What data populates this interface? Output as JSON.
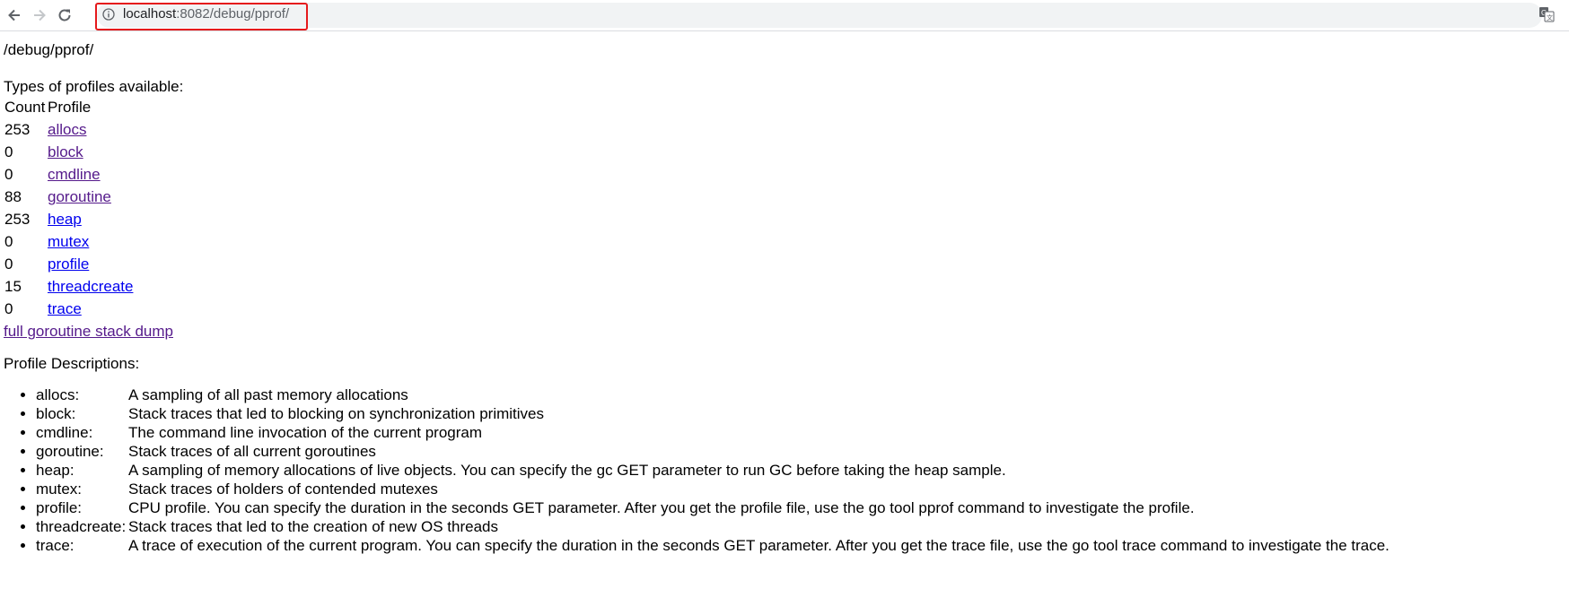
{
  "browser": {
    "url_host": "localhost",
    "url_rest": ":8082/debug/pprof/"
  },
  "page": {
    "heading": "/debug/pprof/",
    "types_heading": "Types of profiles available:",
    "table_headers": [
      "Count",
      "Profile"
    ],
    "profiles": [
      {
        "count": "253",
        "name": "allocs",
        "visited": true
      },
      {
        "count": "0",
        "name": "block",
        "visited": true
      },
      {
        "count": "0",
        "name": "cmdline",
        "visited": true
      },
      {
        "count": "88",
        "name": "goroutine",
        "visited": true
      },
      {
        "count": "253",
        "name": "heap",
        "visited": false
      },
      {
        "count": "0",
        "name": "mutex",
        "visited": false
      },
      {
        "count": "0",
        "name": "profile",
        "visited": false
      },
      {
        "count": "15",
        "name": "threadcreate",
        "visited": false
      },
      {
        "count": "0",
        "name": "trace",
        "visited": false
      }
    ],
    "dump_link": "full goroutine stack dump",
    "descriptions_heading": "Profile Descriptions:",
    "descriptions": [
      {
        "name": "allocs:",
        "text": "A sampling of all past memory allocations"
      },
      {
        "name": "block:",
        "text": "Stack traces that led to blocking on synchronization primitives"
      },
      {
        "name": "cmdline:",
        "text": "The command line invocation of the current program"
      },
      {
        "name": "goroutine:",
        "text": "Stack traces of all current goroutines"
      },
      {
        "name": "heap:",
        "text": "A sampling of memory allocations of live objects. You can specify the gc GET parameter to run GC before taking the heap sample."
      },
      {
        "name": "mutex:",
        "text": "Stack traces of holders of contended mutexes"
      },
      {
        "name": "profile:",
        "text": "CPU profile. You can specify the duration in the seconds GET parameter. After you get the profile file, use the go tool pprof command to investigate the profile."
      },
      {
        "name": "threadcreate:",
        "text": "Stack traces that led to the creation of new OS threads"
      },
      {
        "name": "trace:",
        "text": "A trace of execution of the current program. You can specify the duration in the seconds GET parameter. After you get the trace file, use the go tool trace command to investigate the trace."
      }
    ]
  },
  "colors": {
    "link": "#0000ee",
    "visited_link": "#551a8b",
    "highlight_box": "#e5191c",
    "omnibox_bg": "#f1f3f4"
  },
  "icons": [
    "back-arrow-icon",
    "forward-arrow-icon",
    "reload-icon",
    "info-icon",
    "translate-icon"
  ]
}
